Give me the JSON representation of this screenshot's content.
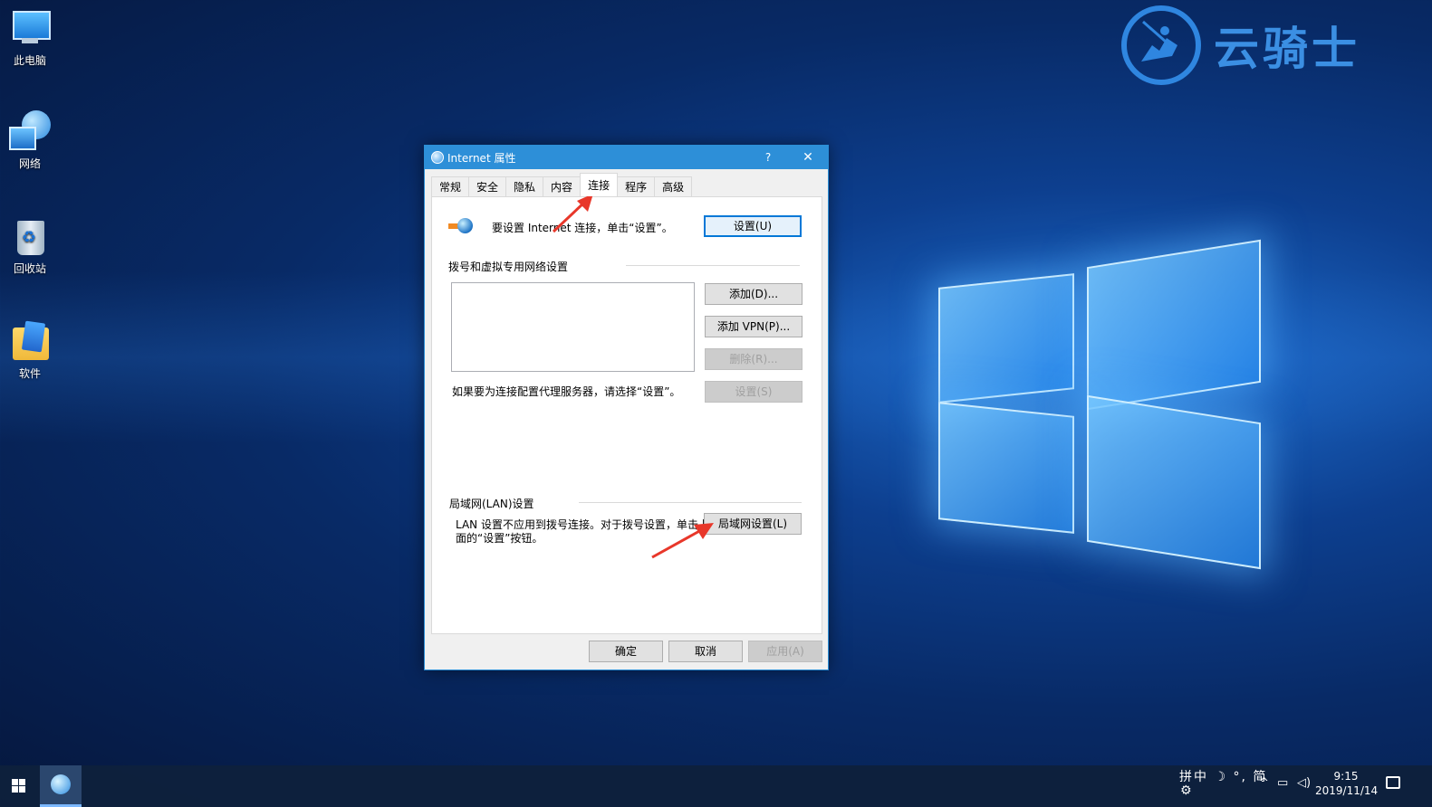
{
  "desktop": {
    "icons": [
      {
        "label": "此电脑",
        "icon": "computer-icon"
      },
      {
        "label": "网络",
        "icon": "network-icon"
      },
      {
        "label": "回收站",
        "icon": "recycle-bin-icon"
      },
      {
        "label": "软件",
        "icon": "folder-icon"
      }
    ],
    "watermark": {
      "text": "云骑士",
      "icon": "knight-logo-icon"
    }
  },
  "dialog": {
    "title": "Internet 属性",
    "help": "?",
    "close": "✕",
    "tabs": [
      {
        "label": "常规",
        "active": false
      },
      {
        "label": "安全",
        "active": false
      },
      {
        "label": "隐私",
        "active": false
      },
      {
        "label": "内容",
        "active": false
      },
      {
        "label": "连接",
        "active": true
      },
      {
        "label": "程序",
        "active": false
      },
      {
        "label": "高级",
        "active": false
      }
    ],
    "setup": {
      "text": "要设置 Internet 连接，单击“设置”。",
      "button": "设置(U)"
    },
    "vpn_group": {
      "title": "拨号和虚拟专用网络设置",
      "add": "添加(D)...",
      "add_vpn": "添加 VPN(P)...",
      "remove": "删除(R)...",
      "settings": "设置(S)",
      "proxy_note": "如果要为连接配置代理服务器，请选择“设置”。"
    },
    "lan_group": {
      "title": "局域网(LAN)设置",
      "note_line1": "LAN 设置不应用到拨号连接。对于拨号设置，单击上",
      "note_line2": "面的“设置”按钮。",
      "button": "局域网设置(L)"
    },
    "footer": {
      "ok": "确定",
      "cancel": "取消",
      "apply": "应用(A)"
    }
  },
  "taskbar": {
    "ime": "拼中 ☽ °, 简",
    "tray_up": "^",
    "clock_time": "9:15",
    "clock_date": "2019/11/14"
  },
  "colors": {
    "titlebar": "#2d8fd8",
    "annotation_arrow": "#e8372a",
    "watermark": "#2f86e0"
  }
}
